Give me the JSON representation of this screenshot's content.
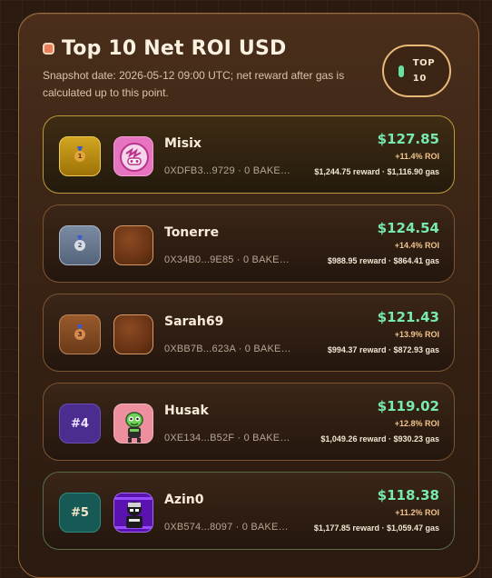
{
  "header": {
    "title": "Top 10 Net ROI USD",
    "subtitle": "Snapshot date: 2026-05-12 09:00 UTC; net reward after gas is calculated up to this point.",
    "badge_line1": "TOP",
    "badge_line2": "10"
  },
  "colors": {
    "accent_green": "#78eab1",
    "gold": "#d2a521",
    "panel_border": "#9b6a3c"
  },
  "rows": [
    {
      "rank": "1",
      "rank_style": "gold-medal",
      "name": "Misix",
      "address": "0XDFB3...9729 · 0 BAKERY...",
      "net": "$127.85",
      "roi": "+11.4% ROI",
      "detail": "$1,244.75 reward · $1,116.90 gas"
    },
    {
      "rank": "2",
      "rank_style": "silver-medal",
      "name": "Tonerre",
      "address": "0X34B0...9E85 · 0 BAKERY...",
      "net": "$124.54",
      "roi": "+14.4% ROI",
      "detail": "$988.95 reward · $864.41 gas"
    },
    {
      "rank": "3",
      "rank_style": "bronze-medal",
      "name": "Sarah69",
      "address": "0XBB7B...623A · 0 BAKERY...",
      "net": "$121.43",
      "roi": "+13.9% ROI",
      "detail": "$994.37 reward · $872.93 gas"
    },
    {
      "rank": "#4",
      "rank_style": "purple",
      "name": "Husak",
      "address": "0XE134...B52F · 0 BAKERY...",
      "net": "$119.02",
      "roi": "+12.8% ROI",
      "detail": "$1,049.26 reward · $930.23 gas"
    },
    {
      "rank": "#5",
      "rank_style": "teal",
      "name": "Azin0",
      "address": "0XB574...8097 · 0 BAKERY...",
      "net": "$118.38",
      "roi": "+11.2% ROI",
      "detail": "$1,177.85 reward · $1,059.47 gas"
    }
  ]
}
